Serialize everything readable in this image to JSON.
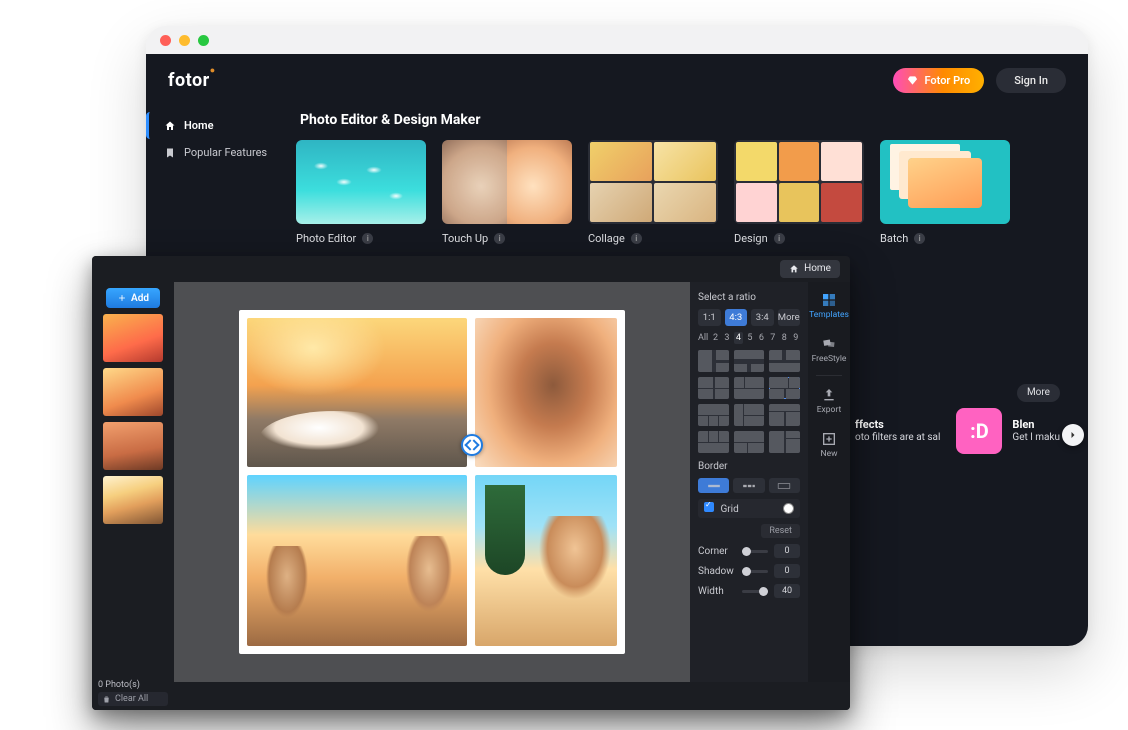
{
  "back": {
    "brand": "fotor",
    "pro_button": "Fotor Pro",
    "signin_button": "Sign In",
    "sidebar": {
      "items": [
        {
          "label": "Home",
          "icon": "home-icon",
          "active": true
        },
        {
          "label": "Popular Features",
          "icon": "bookmark-icon",
          "active": false
        }
      ]
    },
    "section_title": "Photo Editor & Design Maker",
    "cards": [
      {
        "label": "Photo Editor",
        "thumb": "t-photo"
      },
      {
        "label": "Touch Up",
        "thumb": "t-touch"
      },
      {
        "label": "Collage",
        "thumb": "t-collage"
      },
      {
        "label": "Design",
        "thumb": "t-design"
      },
      {
        "label": "Batch",
        "thumb": "t-batch"
      }
    ],
    "more_label": "More",
    "promo": [
      {
        "title": "ffects",
        "subtitle": "oto filters are at\nsal"
      },
      {
        "title": "Blen",
        "subtitle": "Get l\nmaku"
      }
    ]
  },
  "front": {
    "home_button": "Home",
    "add_button": "Add",
    "ratio": {
      "label": "Select a ratio",
      "options": [
        "1:1",
        "4:3",
        "3:4",
        "More"
      ],
      "selected": "4:3"
    },
    "count_strip": {
      "values": [
        "All",
        "2",
        "3",
        "4",
        "5",
        "6",
        "7",
        "8",
        "9"
      ],
      "selected": "4"
    },
    "layout_selected_index": 5,
    "border": {
      "section_label": "Border",
      "grid_label": "Grid",
      "grid_checked": true,
      "grid_color": "#ffffff",
      "reset_label": "Reset",
      "sliders": {
        "corner": {
          "label": "Corner",
          "value": 0
        },
        "shadow": {
          "label": "Shadow",
          "value": 0
        },
        "width": {
          "label": "Width",
          "value": 40
        }
      }
    },
    "tabs": [
      {
        "label": "Templates",
        "icon": "templates-icon",
        "active": true
      },
      {
        "label": "FreeStyle",
        "icon": "freestyle-icon"
      },
      {
        "label": "Export",
        "icon": "export-icon"
      },
      {
        "label": "New",
        "icon": "new-icon"
      }
    ],
    "status": {
      "count_label": "0 Photo(s)",
      "clear_label": "Clear All"
    }
  }
}
